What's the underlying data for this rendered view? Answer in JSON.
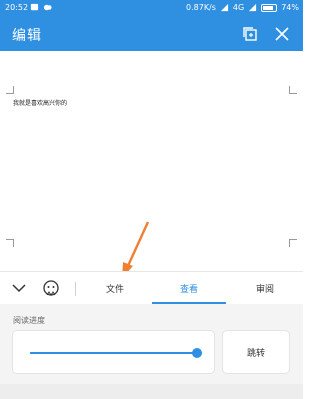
{
  "status_bar": {
    "time": "20:52",
    "network_speed": "0.87K/s",
    "network_type": "4G",
    "battery": "74%",
    "icons": [
      "signal-icon",
      "message-icon",
      "wifi-icon",
      "battery-icon"
    ]
  },
  "app_bar": {
    "title": "编辑",
    "icons": [
      "copy-icon",
      "close-icon"
    ]
  },
  "document": {
    "text": "我就是喜欢高兴你的"
  },
  "toolbar": {
    "tabs": [
      {
        "label": "文件"
      },
      {
        "label": "查看",
        "active": true
      },
      {
        "label": "审阅"
      }
    ],
    "icons": [
      "chevron-down-icon",
      "emoji-icon"
    ]
  },
  "reading_progress": {
    "label": "阅读进度",
    "value_fraction": 0.97,
    "jump_label": "跳转"
  },
  "colors": {
    "accent": "#2f8fe0",
    "annotation_arrow": "#f08030"
  }
}
